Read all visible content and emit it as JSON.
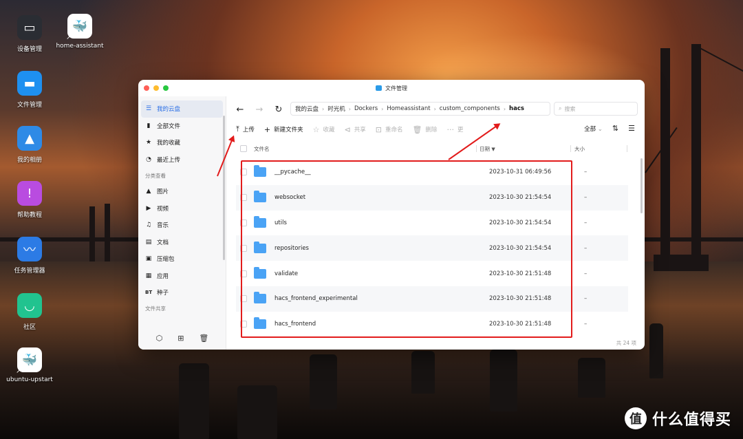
{
  "desktop": {
    "icons": [
      {
        "label": "设备管理",
        "icon": "monitor-icon",
        "color": "#2a2d33"
      },
      {
        "label": "home-assistant",
        "icon": "docker-whale-icon",
        "color": "#ffffff"
      },
      {
        "label": "文件管理",
        "icon": "folder-icon",
        "color": "#1e90f0"
      },
      {
        "label": "我的相册",
        "icon": "photo-mountain-icon",
        "color": "#2e8ae6"
      },
      {
        "label": "帮助教程",
        "icon": "exclamation-icon",
        "color": "#b94ce0"
      },
      {
        "label": "任务管理器",
        "icon": "graph-icon",
        "color": "#2c7be5"
      },
      {
        "label": "社区",
        "icon": "smile-icon",
        "color": "#21c38f"
      },
      {
        "label": "ubuntu-upstart",
        "icon": "docker-whale-icon",
        "color": "#ffffff"
      }
    ]
  },
  "window": {
    "title": "文件管理",
    "traffic_lights": [
      "#ff5f57",
      "#febc2e",
      "#28c840"
    ]
  },
  "sidebar": {
    "items": [
      {
        "label": "我的云盘",
        "icon": "cloud-drive-icon",
        "glyph": "☰"
      },
      {
        "label": "全部文件",
        "icon": "file-icon",
        "glyph": "▮"
      },
      {
        "label": "我的收藏",
        "icon": "star-icon",
        "glyph": "★"
      },
      {
        "label": "最近上传",
        "icon": "clock-icon",
        "glyph": "◔"
      }
    ],
    "section_category": "分类查看",
    "categories": [
      {
        "label": "图片",
        "icon": "image-icon",
        "glyph": "▲"
      },
      {
        "label": "视频",
        "icon": "video-icon",
        "glyph": "▶"
      },
      {
        "label": "音乐",
        "icon": "headphones-icon",
        "glyph": "♫"
      },
      {
        "label": "文档",
        "icon": "document-icon",
        "glyph": "▤"
      },
      {
        "label": "压缩包",
        "icon": "archive-icon",
        "glyph": "▣"
      },
      {
        "label": "应用",
        "icon": "apps-icon",
        "glyph": "▦"
      },
      {
        "label": "种子",
        "icon": "bt-icon",
        "glyph": "BT"
      }
    ],
    "section_share": "文件共享",
    "bottom_icons": [
      "settings-icon",
      "sharing-icon",
      "trash-icon"
    ]
  },
  "nav": {
    "breadcrumb": [
      "我的云盘",
      "时光机",
      "Dockers",
      "Homeassistant",
      "custom_components",
      "hacs"
    ],
    "search_placeholder": "搜索"
  },
  "toolbar": {
    "upload": "上传",
    "new_folder": "新建文件夹",
    "favorite": "收藏",
    "share": "共享",
    "rename": "重命名",
    "delete": "删除",
    "more": "更",
    "filter": "全部"
  },
  "table": {
    "headers": {
      "name": "文件名",
      "date": "日期",
      "size": "大小"
    },
    "rows": [
      {
        "name": "__pycache__",
        "date": "2023-10-31 06:49:56",
        "size": "–"
      },
      {
        "name": "websocket",
        "date": "2023-10-30 21:54:54",
        "size": "–"
      },
      {
        "name": "utils",
        "date": "2023-10-30 21:54:54",
        "size": "–"
      },
      {
        "name": "repositories",
        "date": "2023-10-30 21:54:54",
        "size": "–"
      },
      {
        "name": "validate",
        "date": "2023-10-30 21:51:48",
        "size": "–"
      },
      {
        "name": "hacs_frontend_experimental",
        "date": "2023-10-30 21:51:48",
        "size": "–"
      },
      {
        "name": "hacs_frontend",
        "date": "2023-10-30 21:51:48",
        "size": "–"
      }
    ],
    "footer": "共 24 项"
  },
  "annotation_color": "#e21b1b",
  "watermark": {
    "text": "什么值得买",
    "glyph": "值"
  }
}
